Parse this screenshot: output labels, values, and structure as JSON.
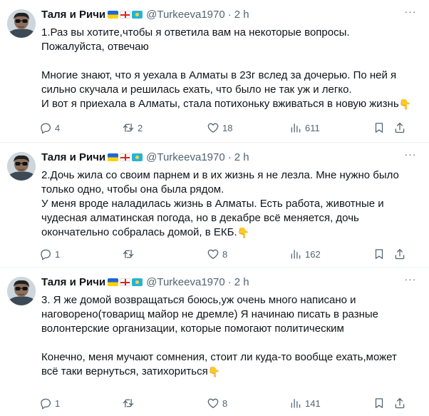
{
  "tweets": [
    {
      "author": "Таля и Ричи",
      "handle": "@Turkeeva1970",
      "dot": "·",
      "time": "2 h",
      "text_lines": [
        "1.Раз вы хотите,чтобы я ответила вам на некоторые вопросы.",
        "Пожалуйста, отвечаю",
        "",
        "Многие знают, что я уехала в Алматы в 23г вслед за дочерью. По ней я",
        "сильно скучала и решилась ехать, что было не так уж и легко.",
        "И вот я приехала в Алматы, стала потихоньку вживаться в новую жизнь"
      ],
      "replies": "4",
      "retweets": "2",
      "likes": "18",
      "views": "611"
    },
    {
      "author": "Таля и Ричи",
      "handle": "@Turkeeva1970",
      "dot": "·",
      "time": "2 h",
      "text_lines": [
        "2.Дочь жила со своим парнем и в их жизнь я не лезла. Мне нужно было",
        "только одно, чтобы она была рядом.",
        "У меня вроде наладилась жизнь в Алматы. Есть работа,  животные и",
        "чудесная алматинская погода,  но в декабре всё меняется, дочь",
        "окончательно собралась домой, в ЕКБ."
      ],
      "replies": "1",
      "retweets": "",
      "likes": "8",
      "views": "162"
    },
    {
      "author": "Таля и Ричи",
      "handle": "@Turkeeva1970",
      "dot": "·",
      "time": "2 h",
      "text_lines": [
        "3. Я же домой возвращаться боюсь,уж очень много написано и",
        "наговорено(товарищ майор не дремле) Я начинаю писать в разные",
        "волонтерские организации, которые помогают политическим",
        "",
        "Конечно, меня мучают сомнения, стоит ли куда-то вообще ехать,может",
        "всё таки вернуться,  затихориться"
      ],
      "replies": "1",
      "retweets": "",
      "likes": "8",
      "views": "141"
    }
  ],
  "icons": {
    "reply": "reply-icon",
    "retweet": "retweet-icon",
    "like": "heart-icon",
    "views": "views-icon",
    "bookmark": "bookmark-icon",
    "share": "share-icon",
    "emoji": "pointing-down-emoji"
  },
  "colors": {
    "text": "#0f1419",
    "secondary": "#536471",
    "divider": "#eff3f4",
    "emoji": "#ffcc4d"
  }
}
